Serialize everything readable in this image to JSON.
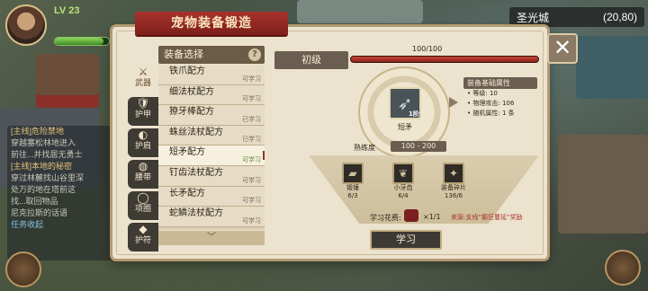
{
  "hud": {
    "level": "LV 23",
    "city": "圣光城",
    "coords": "(20,80)"
  },
  "quest": {
    "lines": [
      "[主线]危险禁地",
      "穿越塞松林地进入",
      "前往...并找居无勇士",
      "[主线]本地的秘密",
      "穿过林麓找山谷里深",
      "处万的地在塔前这",
      "找...取回物品",
      "尼克拉斯的话语"
    ],
    "footer": "任务收起"
  },
  "modal": {
    "title": "宠物装备锻造",
    "close": "✕",
    "list_header": "装备选择",
    "help": "?",
    "scroll_down": "﹀"
  },
  "tabs": [
    {
      "label": "武器",
      "icon": "sword-icon",
      "glyph": "⚔"
    },
    {
      "label": "护甲",
      "icon": "armor-icon",
      "glyph": "🛡"
    },
    {
      "label": "护肩",
      "icon": "shoulder-icon",
      "glyph": "◐"
    },
    {
      "label": "腰带",
      "icon": "belt-icon",
      "glyph": "◍"
    },
    {
      "label": "项圈",
      "icon": "collar-icon",
      "glyph": "◯"
    },
    {
      "label": "护符",
      "icon": "amulet-icon",
      "glyph": "◆"
    }
  ],
  "recipes": [
    {
      "name": "铁爪配方",
      "status": "可学习"
    },
    {
      "name": "细法杖配方",
      "status": "可学习"
    },
    {
      "name": "獠牙棒配方",
      "status": "已学习"
    },
    {
      "name": "蛛丝法杖配方",
      "status": "已学习"
    },
    {
      "name": "短矛配方",
      "status": "可学习"
    },
    {
      "name": "钉齿法杖配方",
      "status": "可学习"
    },
    {
      "name": "长矛配方",
      "status": "可学习"
    },
    {
      "name": "蛇鳞法杖配方",
      "status": "可学习"
    }
  ],
  "level": {
    "name": "初级",
    "count": "100/100",
    "progress": 1.0
  },
  "item": {
    "name": "短矛",
    "badge": "1阶"
  },
  "attributes": {
    "title": "装备基础属性",
    "lines": [
      "等级: 10",
      "物理攻击: 106",
      "随机属性: 1 条"
    ]
  },
  "proficiency": {
    "label": "熟练度",
    "range": "100 - 200"
  },
  "materials": [
    {
      "name": "锻锤",
      "count": "6/3",
      "glyph": "▰"
    },
    {
      "name": "小牙齿",
      "count": "6/4",
      "glyph": "❦"
    },
    {
      "name": "装备碎片",
      "count": "136/6",
      "glyph": "✦"
    }
  ],
  "cost": {
    "label": "学习花费:",
    "value": "×1/1"
  },
  "learn_button": "学习",
  "source": "来源:支线“癫狂蔓延”奖励"
}
